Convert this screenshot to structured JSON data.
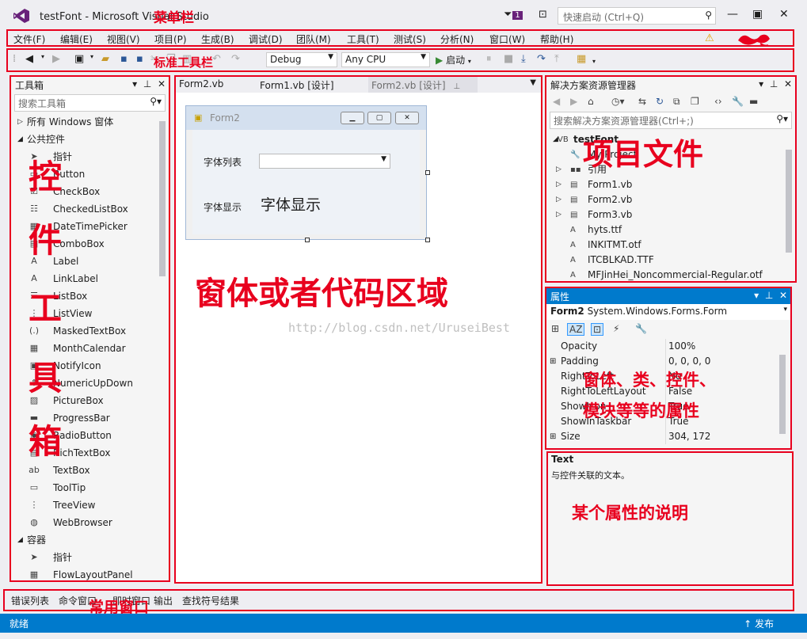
{
  "window": {
    "title": "testFont - Microsoft Visual Studio",
    "notification_count": "1",
    "quick_launch_placeholder": "快速启动 (Ctrl+Q)"
  },
  "menu": [
    "文件(F)",
    "编辑(E)",
    "视图(V)",
    "项目(P)",
    "生成(B)",
    "调试(D)",
    "团队(M)",
    "工具(T)",
    "测试(S)",
    "分析(N)",
    "窗口(W)",
    "帮助(H)"
  ],
  "toolbar": {
    "config": "Debug",
    "platform": "Any CPU",
    "start_label": "启动"
  },
  "annotations": {
    "menubar": "菜单栏",
    "toolbar": "标准工具栏",
    "toolbox_chars": [
      "控",
      "件",
      "工",
      "具",
      "箱"
    ],
    "editor": "窗体或者代码区域",
    "project_files": "项目文件",
    "properties_line1": "窗体、类、控件、",
    "properties_line2": "模块等等的属性",
    "description": "某个属性的说明",
    "common_windows": "常用窗口"
  },
  "toolbox": {
    "title": "工具箱",
    "search_placeholder": "搜索工具箱",
    "items": [
      {
        "label": "所有 Windows 窗体",
        "type": "cat",
        "exp": "▷"
      },
      {
        "label": "公共控件",
        "type": "cat",
        "exp": "◢"
      },
      {
        "label": "指针",
        "icon": "➤"
      },
      {
        "label": "Button",
        "icon": "▭"
      },
      {
        "label": "CheckBox",
        "icon": "☑"
      },
      {
        "label": "CheckedListBox",
        "icon": "☷"
      },
      {
        "label": "DateTimePicker",
        "icon": "▦"
      },
      {
        "label": "ComboBox",
        "icon": "▤"
      },
      {
        "label": "Label",
        "icon": "A"
      },
      {
        "label": "LinkLabel",
        "icon": "A"
      },
      {
        "label": "ListBox",
        "icon": "☰"
      },
      {
        "label": "ListView",
        "icon": "⋮"
      },
      {
        "label": "MaskedTextBox",
        "icon": "(.)"
      },
      {
        "label": "MonthCalendar",
        "icon": "▦"
      },
      {
        "label": "NotifyIcon",
        "icon": "▣"
      },
      {
        "label": "NumericUpDown",
        "icon": "⇕"
      },
      {
        "label": "PictureBox",
        "icon": "▨"
      },
      {
        "label": "ProgressBar",
        "icon": "▬"
      },
      {
        "label": "RadioButton",
        "icon": "◉"
      },
      {
        "label": "RichTextBox",
        "icon": "▤"
      },
      {
        "label": "TextBox",
        "icon": "ab"
      },
      {
        "label": "ToolTip",
        "icon": "▭"
      },
      {
        "label": "TreeView",
        "icon": "⋮"
      },
      {
        "label": "WebBrowser",
        "icon": "◍"
      },
      {
        "label": "容器",
        "type": "cat",
        "exp": "◢"
      },
      {
        "label": "指针",
        "icon": "➤"
      },
      {
        "label": "FlowLayoutPanel",
        "icon": "▦"
      }
    ]
  },
  "editor": {
    "tabs": [
      {
        "label": "Form2.vb",
        "active": false
      },
      {
        "label": "Form1.vb [设计]",
        "active": false
      },
      {
        "label": "Form2.vb [设计]",
        "active": true
      }
    ],
    "form": {
      "title": "Form2",
      "label_font_list": "字体列表",
      "label_font_display": "字体显示",
      "display_text": "字体显示"
    },
    "watermark": "http://blog.csdn.net/UruseiBest"
  },
  "solution": {
    "title": "解决方案资源管理器",
    "search_placeholder": "搜索解决方案资源管理器(Ctrl+;)",
    "items": [
      {
        "label": "testFont",
        "bold": true,
        "icon": "VB",
        "exp": "◢",
        "level": 0
      },
      {
        "label": "My Project",
        "icon": "🔧",
        "level": 1
      },
      {
        "label": "引用",
        "icon": "▪▪",
        "exp": "▷",
        "level": 1
      },
      {
        "label": "Form1.vb",
        "icon": "▤",
        "exp": "▷",
        "level": 1
      },
      {
        "label": "Form2.vb",
        "icon": "▤",
        "exp": "▷",
        "level": 1
      },
      {
        "label": "Form3.vb",
        "icon": "▤",
        "exp": "▷",
        "level": 1
      },
      {
        "label": "hyts.ttf",
        "icon": "A",
        "level": 1
      },
      {
        "label": "INKITMT.otf",
        "icon": "A",
        "level": 1
      },
      {
        "label": "ITCBLKAD.TTF",
        "icon": "A",
        "level": 1
      },
      {
        "label": "MFJinHei_Noncommercial-Regular.otf",
        "icon": "A",
        "level": 1
      }
    ]
  },
  "properties": {
    "title": "属性",
    "object_name": "Form2",
    "object_type": "System.Windows.Forms.Form",
    "rows": [
      {
        "name": "Opacity",
        "value": "100%"
      },
      {
        "name": "Padding",
        "value": "0, 0, 0, 0",
        "exp": "⊞"
      },
      {
        "name": "RightToLeft",
        "value": "No"
      },
      {
        "name": "RightToLeftLayout",
        "value": "False"
      },
      {
        "name": "ShowIcon",
        "value": "True"
      },
      {
        "name": "ShowInTaskbar",
        "value": "True"
      },
      {
        "name": "Size",
        "value": "304, 172",
        "exp": "⊞"
      }
    ]
  },
  "description": {
    "title": "Text",
    "text": "与控件关联的文本。"
  },
  "bottom_tabs": [
    "错误列表",
    "命令窗口",
    "即时窗口",
    "输出",
    "查找符号结果"
  ],
  "status": {
    "left": "就绪",
    "right": "发布"
  }
}
